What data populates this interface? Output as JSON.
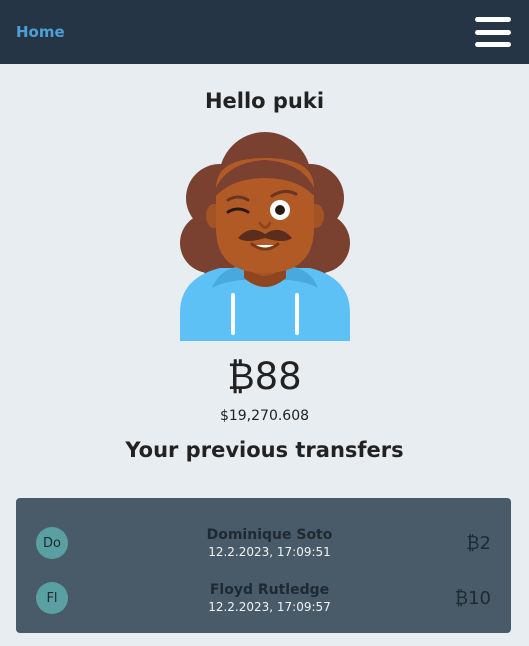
{
  "nav": {
    "home_label": "Home"
  },
  "greeting": "Hello puki",
  "balance": {
    "btc": "₿88",
    "usd": "$19,270.608"
  },
  "transfers": {
    "title": "Your previous transfers",
    "items": [
      {
        "initials": "Do",
        "name": "Dominique Soto",
        "date": "12.2.2023, 17:09:51",
        "amount": "₿2"
      },
      {
        "initials": "Fl",
        "name": "Floyd Rutledge",
        "date": "12.2.2023, 17:09:57",
        "amount": "₿10"
      }
    ]
  },
  "colors": {
    "navbar": "#263545",
    "accent": "#4ea0d4",
    "background": "#e7edf0",
    "transfers_box": "#495a68",
    "initials_badge": "#5aa0a3"
  }
}
